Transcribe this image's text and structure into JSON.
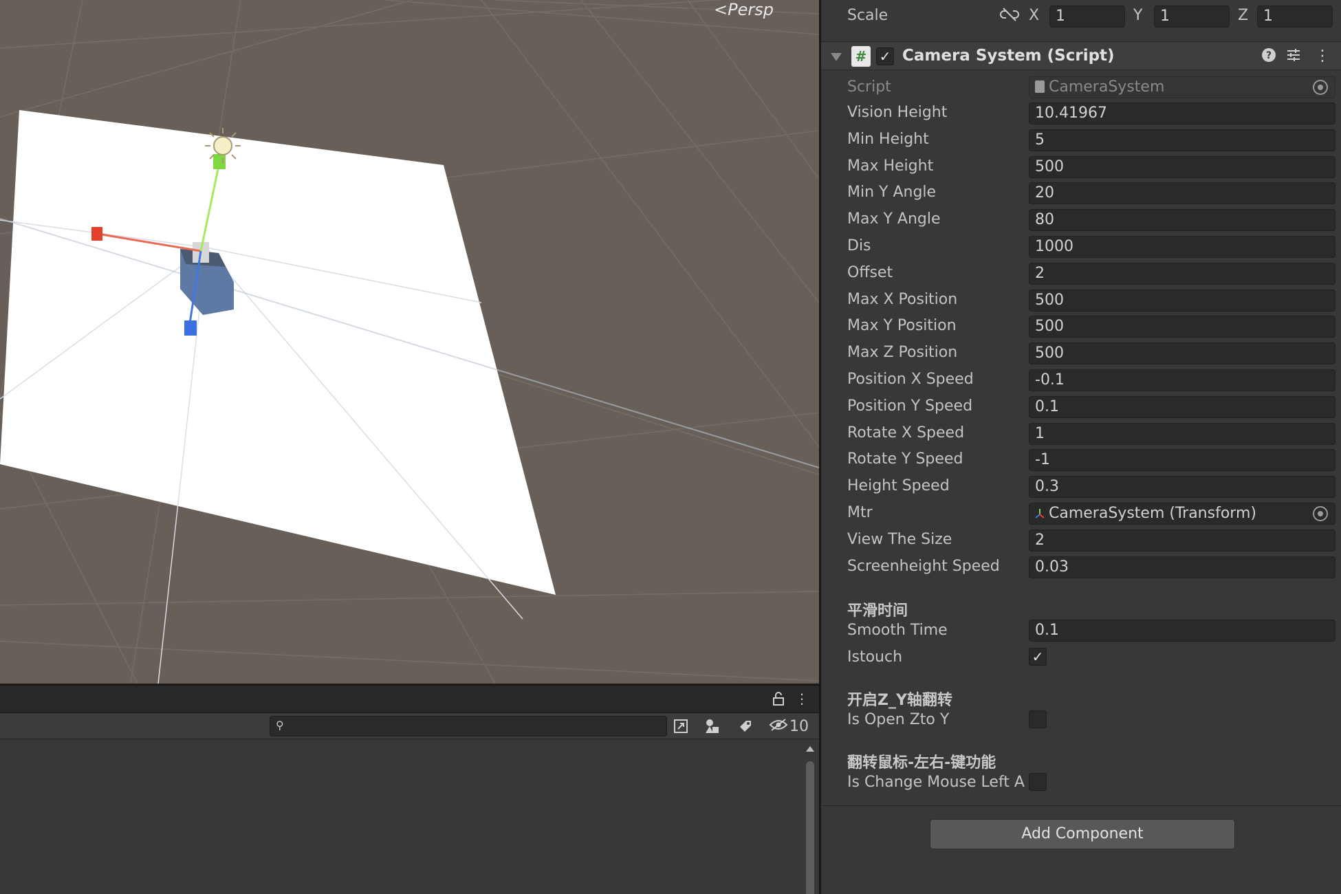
{
  "scene": {
    "persp_label": "Persp"
  },
  "inspector": {
    "scale": {
      "label": "Scale",
      "x_label": "X",
      "x_value": "1",
      "y_label": "Y",
      "y_value": "1",
      "z_label": "Z",
      "z_value": "1"
    },
    "component": {
      "title": "Camera System (Script)",
      "enabled": true,
      "script_label": "Script",
      "script_value": "CameraSystem",
      "fields": [
        {
          "label": "Vision Height",
          "value": "10.41967"
        },
        {
          "label": "Min Height",
          "value": "5"
        },
        {
          "label": "Max Height",
          "value": "500"
        },
        {
          "label": "Min Y Angle",
          "value": "20"
        },
        {
          "label": "Max Y Angle",
          "value": "80"
        },
        {
          "label": "Dis",
          "value": "1000"
        },
        {
          "label": "Offset",
          "value": "2"
        },
        {
          "label": "Max X Position",
          "value": "500"
        },
        {
          "label": "Max Y Position",
          "value": "500"
        },
        {
          "label": "Max Z Position",
          "value": "500"
        },
        {
          "label": "Position X Speed",
          "value": "-0.1"
        },
        {
          "label": "Position Y Speed",
          "value": "0.1"
        },
        {
          "label": "Rotate X Speed",
          "value": "1"
        },
        {
          "label": "Rotate Y Speed",
          "value": "-1"
        },
        {
          "label": "Height Speed",
          "value": "0.3"
        },
        {
          "label": "Mtr",
          "value": "CameraSystem (Transform)"
        },
        {
          "label": "View The Size",
          "value": "2"
        },
        {
          "label": "Screenheight Speed",
          "value": "0.03"
        }
      ],
      "section_smooth": "平滑时间",
      "smooth_time_label": "Smooth Time",
      "smooth_time_value": "0.1",
      "istouch_label": "Istouch",
      "istouch_checked": true,
      "section_zy": "开启Z_Y轴翻转",
      "open_zy_label": "Is Open Zto Y",
      "open_zy_checked": false,
      "section_mouse": "翻转鼠标-左右-键功能",
      "mouse_label": "Is Change Mouse Left A",
      "mouse_checked": false
    },
    "add_component_label": "Add Component"
  },
  "bottom": {
    "hidden_count": "10"
  }
}
